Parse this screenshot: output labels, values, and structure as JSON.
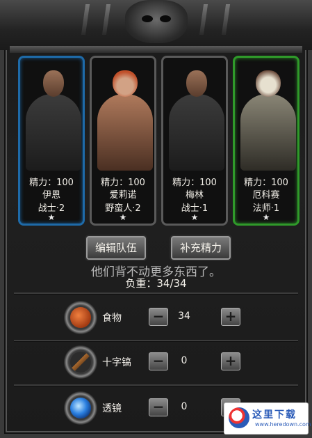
{
  "heroes": [
    {
      "stamina": "精力：100",
      "name": "伊恩",
      "class": "战士·2",
      "star": "★",
      "frame": "blue"
    },
    {
      "stamina": "精力：100",
      "name": "爱莉诺",
      "class": "野蛮人·2",
      "star": "★",
      "frame": "gray"
    },
    {
      "stamina": "精力：100",
      "name": "梅林",
      "class": "战士·1",
      "star": "★",
      "frame": "gray"
    },
    {
      "stamina": "精力：100",
      "name": "厄科赛",
      "class": "法师·1",
      "star": "★",
      "frame": "green"
    }
  ],
  "buttons": {
    "edit_team": "编辑队伍",
    "refill_stamina": "补充精力"
  },
  "message": "他们背不动更多东西了。",
  "load": "负重：34/34",
  "items": [
    {
      "label": "食物",
      "qty": "34",
      "icon": "meat-icon"
    },
    {
      "label": "十字镐",
      "qty": "0",
      "icon": "pickaxe-icon"
    },
    {
      "label": "透镜",
      "qty": "0",
      "icon": "lens-icon"
    }
  ],
  "stepper": {
    "minus": "−",
    "plus": "+"
  },
  "watermark": {
    "text": "这里下载",
    "url": "www.heredown.com"
  },
  "colors": {
    "blue_frame": "#1e6aa8",
    "green_frame": "#2f9a2a"
  }
}
